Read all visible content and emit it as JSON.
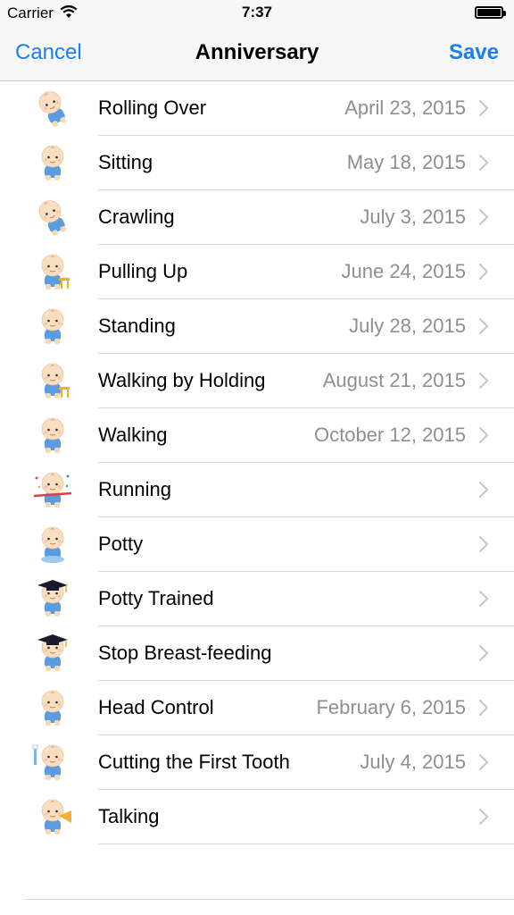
{
  "status_bar": {
    "carrier": "Carrier",
    "time": "7:37"
  },
  "nav": {
    "cancel_label": "Cancel",
    "title": "Anniversary",
    "save_label": "Save"
  },
  "colors": {
    "accent": "#1a7ef5",
    "secondary_text": "#8e8e93",
    "separator": "#d8d8dc"
  },
  "items": [
    {
      "label": "Rolling Over",
      "date": "April 23, 2015",
      "icon": "baby-rolling-over-icon"
    },
    {
      "label": "Sitting",
      "date": "May 18, 2015",
      "icon": "baby-sitting-icon"
    },
    {
      "label": "Crawling",
      "date": "July 3, 2015",
      "icon": "baby-crawling-icon"
    },
    {
      "label": "Pulling Up",
      "date": "June 24, 2015",
      "icon": "baby-pulling-up-icon"
    },
    {
      "label": "Standing",
      "date": "July 28, 2015",
      "icon": "baby-standing-icon"
    },
    {
      "label": "Walking by Holding",
      "date": "August 21, 2015",
      "icon": "baby-walking-holding-icon"
    },
    {
      "label": "Walking",
      "date": "October 12, 2015",
      "icon": "baby-walking-icon"
    },
    {
      "label": "Running",
      "date": "",
      "icon": "baby-running-icon"
    },
    {
      "label": "Potty",
      "date": "",
      "icon": "baby-potty-icon"
    },
    {
      "label": "Potty Trained",
      "date": "",
      "icon": "baby-graduate-icon"
    },
    {
      "label": "Stop Breast-feeding",
      "date": "",
      "icon": "baby-graduate-icon"
    },
    {
      "label": "Head Control",
      "date": "February 6, 2015",
      "icon": "baby-head-control-icon"
    },
    {
      "label": "Cutting the First Tooth",
      "date": "July 4, 2015",
      "icon": "baby-tooth-icon"
    },
    {
      "label": "Talking",
      "date": "",
      "icon": "baby-talking-icon"
    }
  ]
}
